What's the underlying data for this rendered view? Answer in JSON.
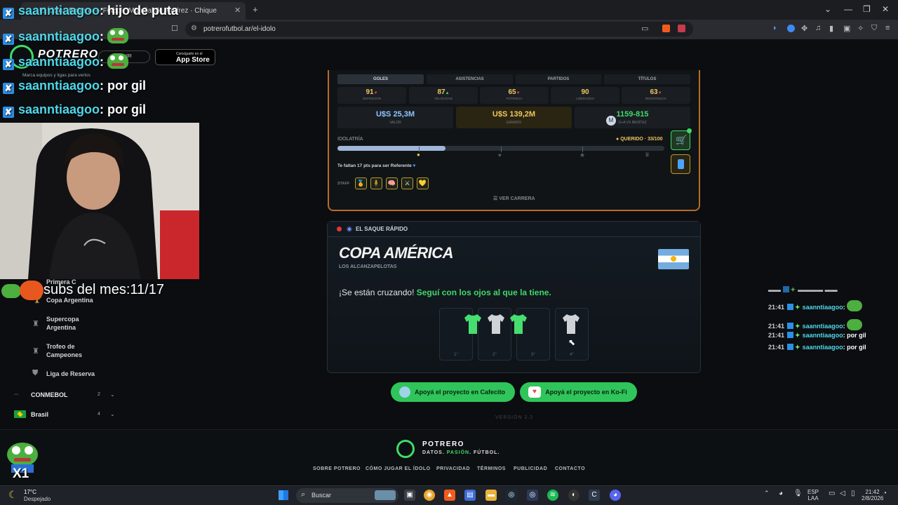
{
  "browser": {
    "tab_title": "El Ídolo · Potrero — Futbol · Mundial de Ajedrez · Chique",
    "url": "potrerofutbol.ar/el-idolo"
  },
  "site_sidebar": {
    "brand": "POTRERO",
    "follow_label": "SEGUIR",
    "appstore_small": "Consíguelo en el",
    "appstore_big": "App Store",
    "hint": "Marca equipos y ligas para verlos",
    "items": [
      {
        "label": "Primera C"
      },
      {
        "label": "Copa Argentina"
      },
      {
        "label": "Supercopa Argentina"
      },
      {
        "label": "Trofeo de Campeones"
      },
      {
        "label": "Liga de Reserva"
      }
    ],
    "confederations": [
      {
        "label": "CONMEBOL",
        "count": "2"
      },
      {
        "label": "Brasil",
        "count": "4"
      }
    ]
  },
  "player_card": {
    "tabs": [
      "GOLES",
      "ASISTENCIAS",
      "PARTIDOS",
      "TÍTULOS"
    ],
    "attributes": [
      {
        "value": "91",
        "arrow": "▼",
        "label": "DEFINICIÓN",
        "color": "#f0c75e"
      },
      {
        "value": "87",
        "arrow": "▲",
        "label": "VELOCIDAD",
        "color": "#f0c75e"
      },
      {
        "value": "65",
        "arrow": "▼",
        "label": "POTENCIA",
        "color": "#f0c75e"
      },
      {
        "value": "90",
        "arrow": "",
        "label": "LIDERAZGO",
        "color": "#f0c75e"
      },
      {
        "value": "63",
        "arrow": "▼",
        "label": "RESISTENCIA",
        "color": "#f0c75e"
      }
    ],
    "big_stats": [
      {
        "value": "U$S 25,3M",
        "label": "VALOR",
        "color": "#8ec5ff"
      },
      {
        "value": "U$S 139,2M",
        "label": "GANADO",
        "color": "#f0c75e"
      },
      {
        "value": "1159-815",
        "label": "G+A VS BENÍTEZ",
        "color": "#41d86a"
      }
    ],
    "idolatria_label": "IDOLATRÍA",
    "idolatria_status": "QUERIDO · 33/100",
    "idolatria_progress": 0.33,
    "faltan": "Te faltan 17 pts para ser Referente",
    "staff_label": "STAFF",
    "staff_icons": [
      "🏅",
      "🧍",
      "🧠",
      "⚔",
      "💛"
    ],
    "ver_carrera": "VER CARRERA"
  },
  "saque": {
    "section_label": "EL SAQUE RÁPIDO",
    "title": "COPA AMÉRICA",
    "subtitle": "LOS ALCANZAPELOTAS",
    "message_plain": "¡Se están cruzando! ",
    "message_green": "Seguí con los ojos al que la tiene.",
    "slots": [
      {
        "num": "1°"
      },
      {
        "num": "2°"
      },
      {
        "num": "3°"
      },
      {
        "num": "4°"
      }
    ]
  },
  "donations": {
    "cafecito": "Apoyá el proyecto en Cafecito",
    "kofi": "Apoyá el proyecto en Ko-Fi"
  },
  "version": "VERSIÓN 2.2",
  "footer": {
    "brand": "POTRERO",
    "tag_a": "DATOS. ",
    "tag_b": "PASIÓN",
    "tag_c": ". FÚTBOL.",
    "links": [
      "SOBRE POTRERO",
      "CÓMO JUGAR EL ÍDOLO",
      "PRIVACIDAD",
      "TÉRMINOS",
      "PUBLICIDAD",
      "CONTACTO"
    ]
  },
  "stream": {
    "top_chat": [
      {
        "user": "saanntiaagoo",
        "msg": "hijo de puta",
        "emote": false
      },
      {
        "user": "saanntiaagoo",
        "msg": "",
        "emote": true
      },
      {
        "user": "saanntiaagoo",
        "msg": "",
        "emote": true
      },
      {
        "user": "saanntiaagoo",
        "msg": "por gil",
        "emote": false
      },
      {
        "user": "saanntiaagoo",
        "msg": "por gil",
        "emote": false
      }
    ],
    "subs": "subs del mes:11/17",
    "side_chat": [
      {
        "time": "21:41",
        "user": "saanntiaagoo",
        "msg": "",
        "emote": true
      },
      {
        "time": "21:41",
        "user": "saanntiaagoo",
        "msg": "",
        "emote": true
      },
      {
        "time": "21:41",
        "user": "saanntiaagoo",
        "msg": "por gil",
        "emote": false
      },
      {
        "time": "21:41",
        "user": "saanntiaagoo",
        "msg": "por gil",
        "emote": false
      }
    ],
    "pepe_label": "X1"
  },
  "taskbar": {
    "temp": "17°C",
    "weather": "Despejado",
    "search": "Buscar",
    "lang1": "ESP",
    "lang2": "LAA",
    "time": "21:42",
    "date": "2/8/2026"
  }
}
